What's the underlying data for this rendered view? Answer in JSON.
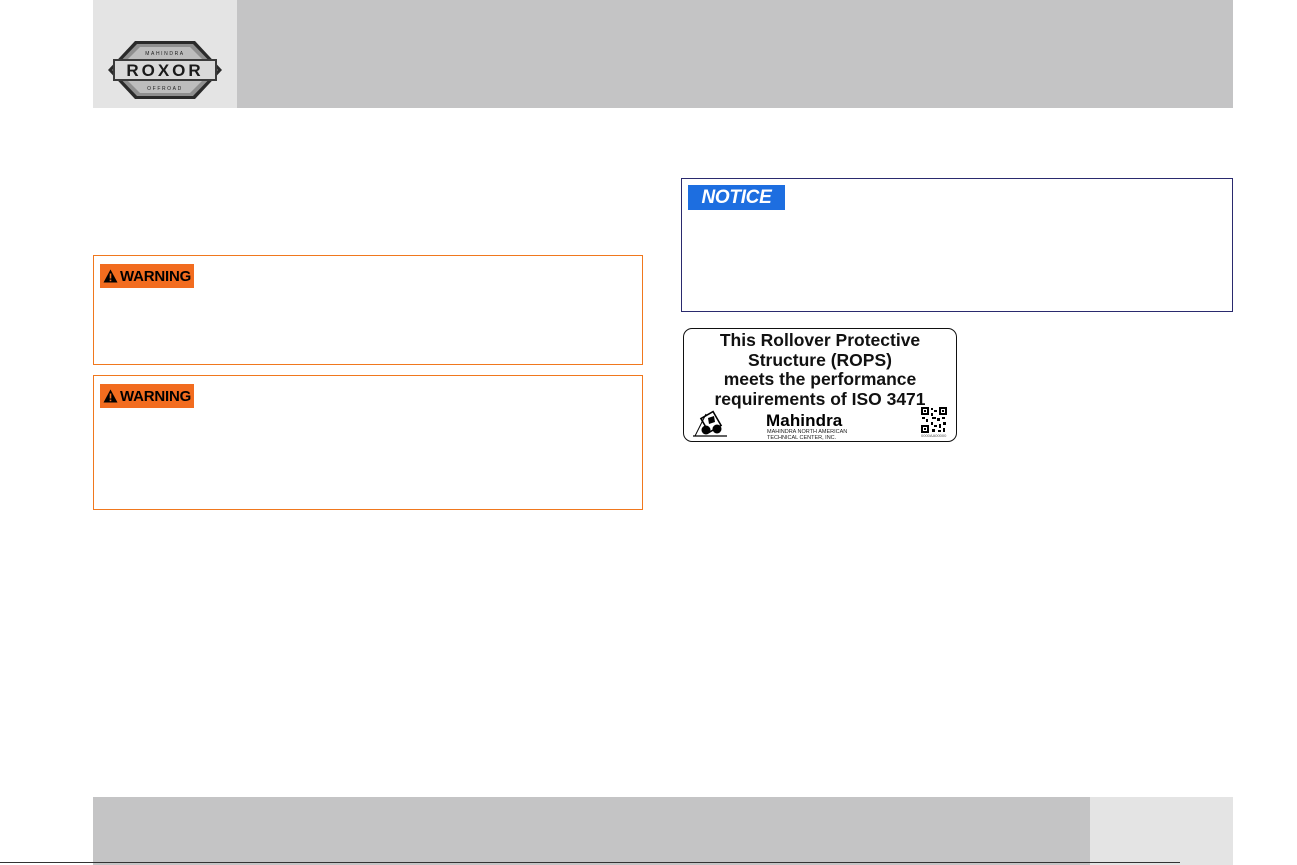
{
  "header": {
    "logo": {
      "brand": "ROXOR",
      "top_text": "MAHINDRA",
      "bottom_text": "OFFROAD"
    }
  },
  "warnings": [
    {
      "label": "WARNING",
      "color": "#f26c1f"
    },
    {
      "label": "WARNING",
      "color": "#f26c1f"
    }
  ],
  "notice": {
    "label": "NOTICE",
    "color": "#1d6ee0"
  },
  "rops_label": {
    "lines": [
      "This Rollover Protective",
      "Structure (ROPS)",
      "meets the performance",
      "requirements of ISO 3471"
    ],
    "brand": "Mahindra",
    "brand_sub": [
      "MAHINDRA NORTH AMERICAN",
      "TECHNICAL CENTER, INC."
    ],
    "part_number": "0000AA00000",
    "icon": "rollover-icon"
  }
}
